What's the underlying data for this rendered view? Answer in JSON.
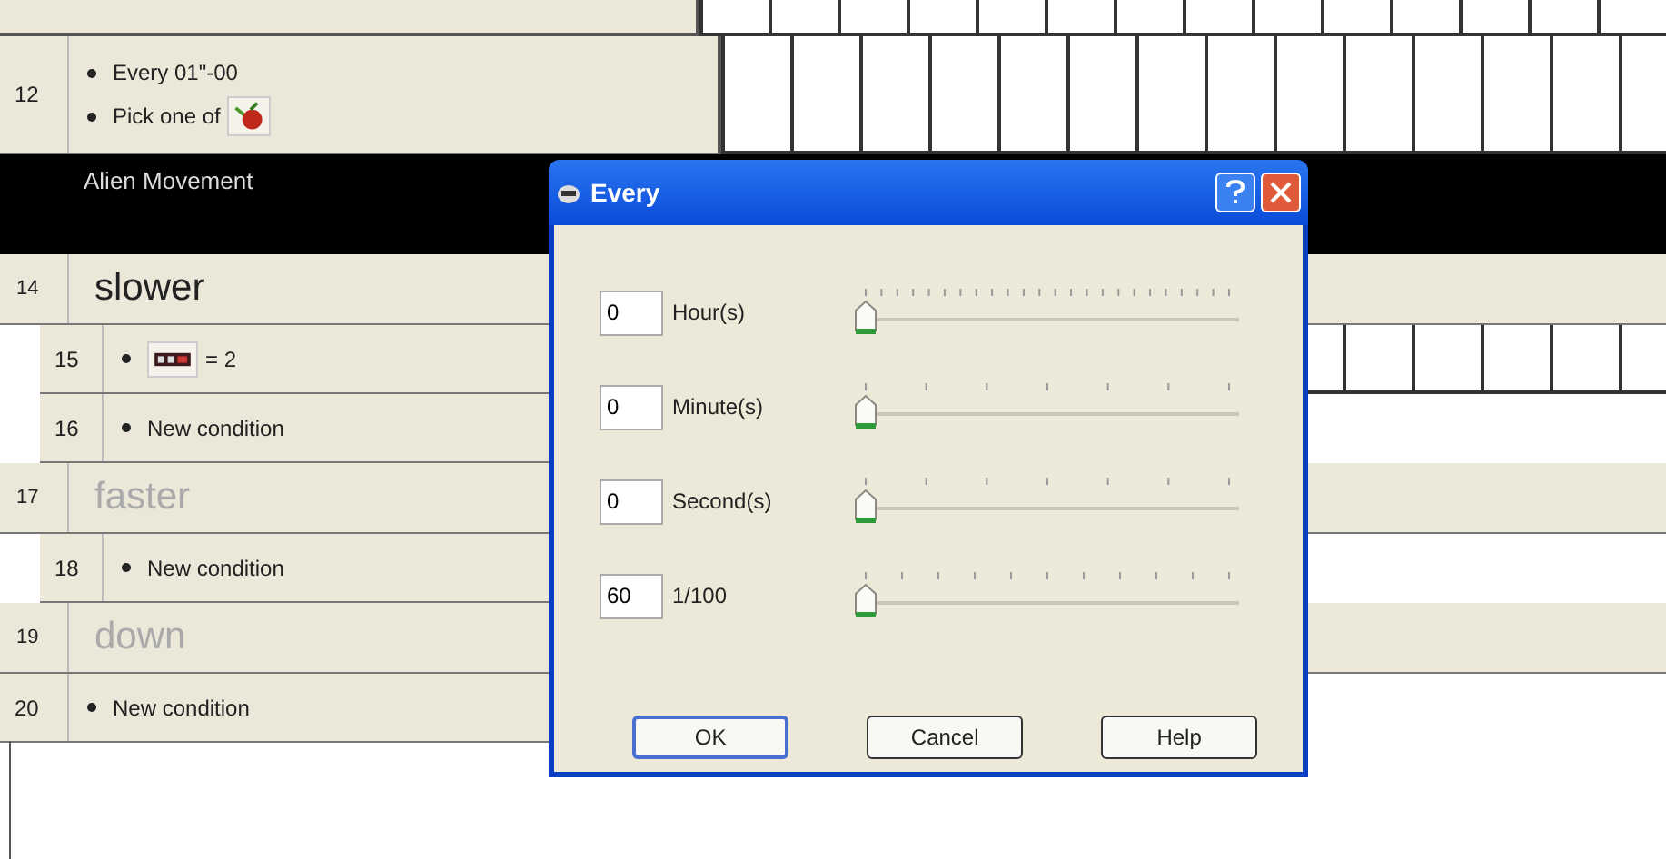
{
  "rows": [
    {
      "kind": "event",
      "number": "12",
      "nested": false,
      "grid": true,
      "conditions": [
        {
          "kind": "plain",
          "text": "Every 01\"-00"
        },
        {
          "kind": "icon-after",
          "text": "Pick one of"
        }
      ]
    },
    {
      "kind": "group",
      "title": "Alien Movement"
    },
    {
      "kind": "label",
      "number": "14",
      "text": "slower",
      "dimmed": false
    },
    {
      "kind": "event",
      "number": "15",
      "nested": true,
      "grid": true,
      "conditions": [
        {
          "kind": "icon-before",
          "text": "= 2"
        }
      ]
    },
    {
      "kind": "event",
      "number": "16",
      "nested": true,
      "grid": false,
      "conditions": [
        {
          "kind": "plain",
          "text": "New condition"
        }
      ]
    },
    {
      "kind": "label",
      "number": "17",
      "text": "faster",
      "dimmed": true
    },
    {
      "kind": "event",
      "number": "18",
      "nested": true,
      "grid": false,
      "conditions": [
        {
          "kind": "plain",
          "text": "New condition"
        }
      ]
    },
    {
      "kind": "label",
      "number": "19",
      "text": "down",
      "dimmed": true
    },
    {
      "kind": "event",
      "number": "20",
      "nested": false,
      "grid": false,
      "conditions": [
        {
          "kind": "plain",
          "text": "New condition"
        }
      ]
    }
  ],
  "dialog": {
    "title": "Every",
    "fields": [
      {
        "value": "0",
        "label": "Hour(s)",
        "level": 0
      },
      {
        "value": "0",
        "label": "Minute(s)",
        "level": 0
      },
      {
        "value": "0",
        "label": "Second(s)",
        "level": 0
      },
      {
        "value": "60",
        "label": "1/100",
        "level": 0
      }
    ],
    "buttons": [
      {
        "label": "OK",
        "selected": true
      },
      {
        "label": "Cancel",
        "selected": false
      },
      {
        "label": "Help",
        "selected": false
      }
    ]
  }
}
